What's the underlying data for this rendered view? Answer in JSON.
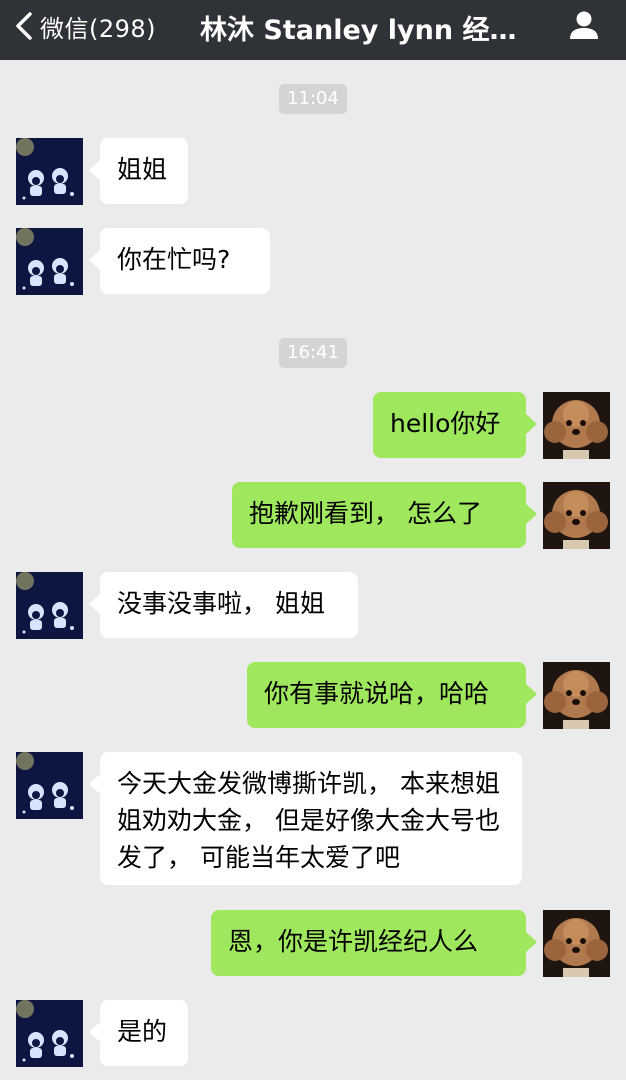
{
  "header": {
    "back_label": "微信(298)",
    "title": "林沐 Stanley lynn 经…"
  },
  "colors": {
    "nav_bg": "#2f3236",
    "chat_bg": "#ebebeb",
    "outgoing_bubble": "#9fe85e",
    "incoming_bubble": "#ffffff"
  },
  "icons": {
    "back": "chevron-left-icon",
    "profile": "person-icon"
  },
  "timestamps": [
    "11:04",
    "16:41"
  ],
  "messages": [
    {
      "side": "in",
      "text": "姐姐"
    },
    {
      "side": "in",
      "text": "你在忙吗?"
    },
    {
      "side": "out",
      "text": "hello你好"
    },
    {
      "side": "out",
      "text": "抱歉刚看到， 怎么了"
    },
    {
      "side": "in",
      "text": "没事没事啦， 姐姐"
    },
    {
      "side": "out",
      "text": "你有事就说哈，哈哈"
    },
    {
      "side": "in",
      "text": "今天大金发微博撕许凯， 本来想姐姐劝劝大金， 但是好像大金大号也发了， 可能当年太爱了吧"
    },
    {
      "side": "out",
      "text": "恩，你是许凯经纪人么"
    },
    {
      "side": "in",
      "text": "是的"
    }
  ]
}
